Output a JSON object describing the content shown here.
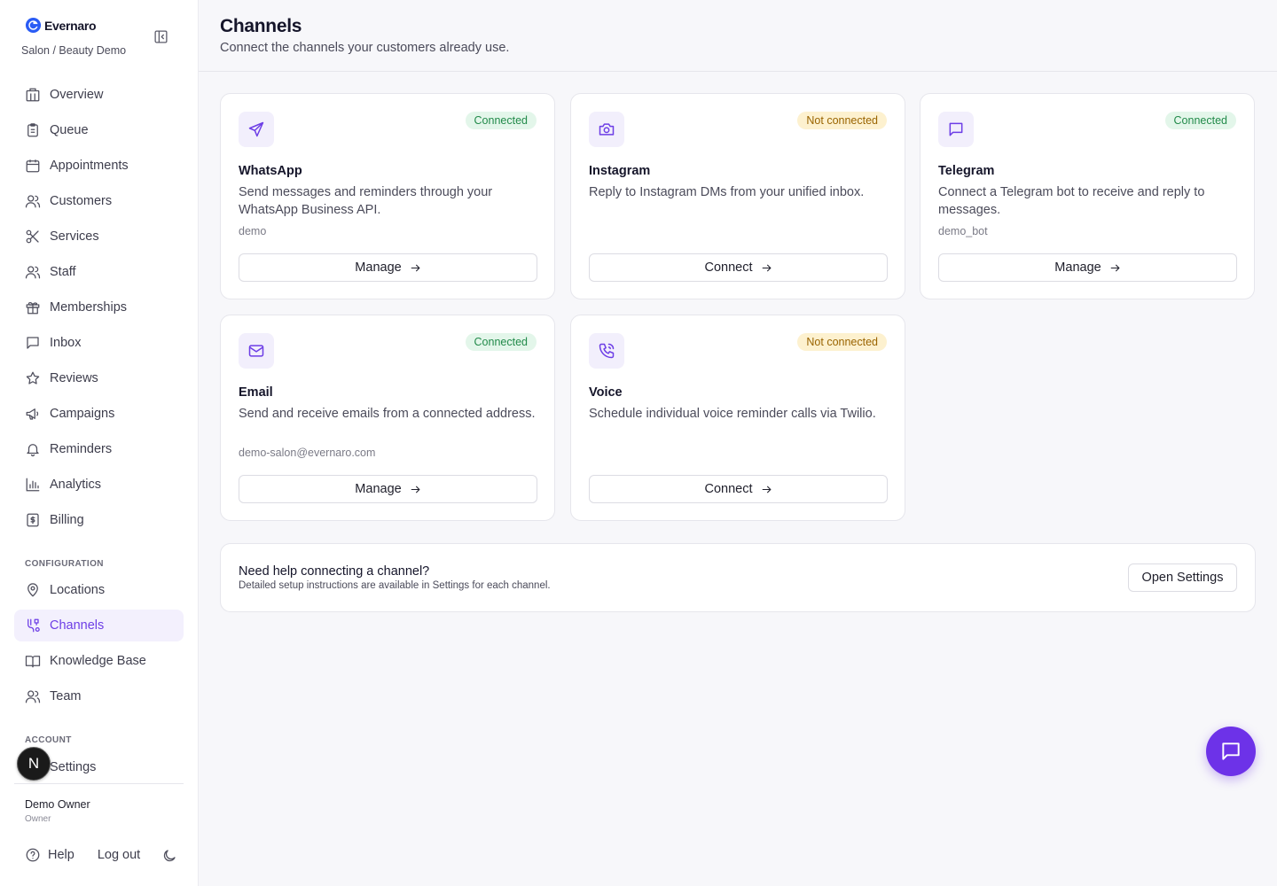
{
  "brand": {
    "name": "Evernaro",
    "subtitle": "Salon / Beauty Demo"
  },
  "sidebar": {
    "main_items": [
      {
        "label": "Overview",
        "icon": "building-icon"
      },
      {
        "label": "Queue",
        "icon": "clipboard-icon"
      },
      {
        "label": "Appointments",
        "icon": "calendar-icon"
      },
      {
        "label": "Customers",
        "icon": "users-icon"
      },
      {
        "label": "Services",
        "icon": "scissors-icon"
      },
      {
        "label": "Staff",
        "icon": "users-icon"
      },
      {
        "label": "Memberships",
        "icon": "gift-icon"
      },
      {
        "label": "Inbox",
        "icon": "message-icon"
      },
      {
        "label": "Reviews",
        "icon": "star-icon"
      },
      {
        "label": "Campaigns",
        "icon": "megaphone-icon"
      },
      {
        "label": "Reminders",
        "icon": "bell-icon"
      },
      {
        "label": "Analytics",
        "icon": "bar-chart-icon"
      },
      {
        "label": "Billing",
        "icon": "receipt-icon"
      }
    ],
    "config_heading": "CONFIGURATION",
    "config_items": [
      {
        "label": "Locations",
        "icon": "map-pin-icon"
      },
      {
        "label": "Channels",
        "icon": "route-icon",
        "active": true
      },
      {
        "label": "Knowledge Base",
        "icon": "book-icon"
      },
      {
        "label": "Team",
        "icon": "users-icon"
      }
    ],
    "account_heading": "ACCOUNT",
    "account_items": [
      {
        "label": "Settings",
        "icon": "gear-icon"
      }
    ],
    "user": {
      "name": "Demo Owner",
      "role": "Owner"
    },
    "footer": {
      "help": "Help",
      "logout": "Log out"
    },
    "next_badge": "N"
  },
  "header": {
    "title": "Channels",
    "subtitle": "Connect the channels your customers already use."
  },
  "channels": [
    {
      "name": "WhatsApp",
      "status": "Connected",
      "connected": true,
      "description": "Send messages and reminders through your WhatsApp Business API.",
      "meta": "demo",
      "action": "Manage",
      "icon": "send-icon"
    },
    {
      "name": "Instagram",
      "status": "Not connected",
      "connected": false,
      "description": "Reply to Instagram DMs from your unified inbox.",
      "meta": "",
      "action": "Connect",
      "icon": "camera-icon"
    },
    {
      "name": "Telegram",
      "status": "Connected",
      "connected": true,
      "description": "Connect a Telegram bot to receive and reply to messages.",
      "meta": "demo_bot",
      "action": "Manage",
      "icon": "message-square-icon"
    },
    {
      "name": "Email",
      "status": "Connected",
      "connected": true,
      "description": "Send and receive emails from a connected address.",
      "meta": "demo-salon@evernaro.com",
      "action": "Manage",
      "icon": "mail-icon"
    },
    {
      "name": "Voice",
      "status": "Not connected",
      "connected": false,
      "description": "Schedule individual voice reminder calls via Twilio.",
      "meta": "",
      "action": "Connect",
      "icon": "phone-call-icon"
    }
  ],
  "help": {
    "title": "Need help connecting a channel?",
    "subtitle": "Detailed setup instructions are available in Settings for each channel.",
    "button": "Open Settings"
  },
  "colors": {
    "accent": "#6d3ee6",
    "connected_bg": "#e3f6ea",
    "connected_fg": "#228a4a",
    "pending_bg": "#fdf1cf",
    "pending_fg": "#9a6400"
  }
}
